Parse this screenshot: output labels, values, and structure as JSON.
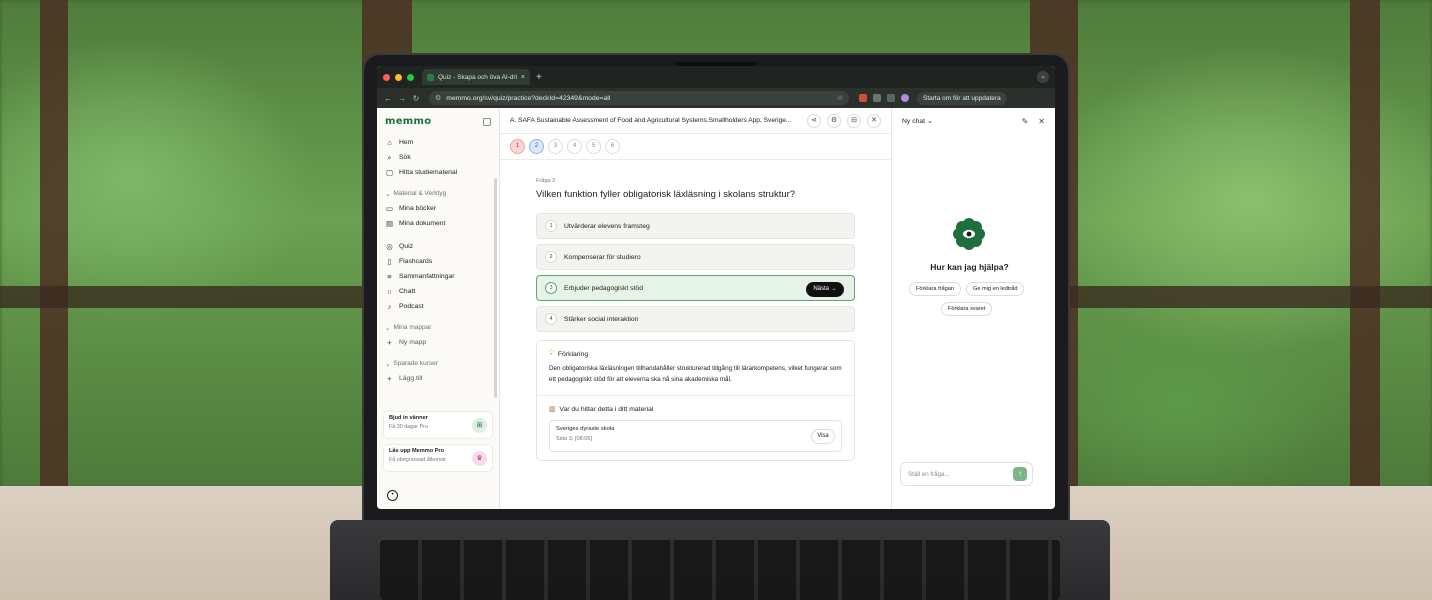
{
  "browser": {
    "tab_title": "Quiz - Skapa och öva AI-driv",
    "tab_close": "×",
    "new_tab": "+",
    "url": "memmo.org/sv/quiz/practice?deckId=42349&mode=all",
    "update_button": "Starta om för att uppdatera"
  },
  "sidebar": {
    "logo": "memmo",
    "items_top": [
      {
        "label": "Hem",
        "icon": "home-icon"
      },
      {
        "label": "Sök",
        "icon": "search-icon"
      },
      {
        "label": "Hitta studiematerial",
        "icon": "book-search-icon"
      }
    ],
    "section_material": "Material & Verktyg",
    "items_material": [
      {
        "label": "Mina böcker",
        "icon": "book-icon"
      },
      {
        "label": "Mina dokument",
        "icon": "document-icon"
      }
    ],
    "items_tools": [
      {
        "label": "Quiz",
        "icon": "quiz-icon"
      },
      {
        "label": "Flashcards",
        "icon": "flashcards-icon"
      },
      {
        "label": "Sammanfattningar",
        "icon": "summary-icon"
      },
      {
        "label": "Chatt",
        "icon": "chat-icon"
      },
      {
        "label": "Podcast",
        "icon": "podcast-icon"
      }
    ],
    "section_folders": "Mina mappar",
    "new_folder": "Ny mapp",
    "section_courses": "Sparade kurser",
    "add_course": "Lägg till",
    "promo_invite": {
      "title": "Bjud in vänner",
      "subtitle": "Få 30 dagar Pro"
    },
    "promo_pro": {
      "title": "Lås upp Memmo Pro",
      "subtitle": "Få obegränsad åtkomst"
    }
  },
  "quiz": {
    "title": "A. SAFA Sustainable Assessment of Food and Agricultural Systems.Smallholders App, Sverige...",
    "steps": [
      "1",
      "2",
      "3",
      "4",
      "5",
      "6"
    ],
    "question_number": "Fråga 2",
    "question": "Vilken funktion fyller obligatorisk läxläsning i skolans struktur?",
    "options": [
      {
        "n": "1",
        "text": "Utvärderar elevens framsteg"
      },
      {
        "n": "2",
        "text": "Kompenserar för studiero"
      },
      {
        "n": "3",
        "text": "Erbjuder pedagogiskt stöd"
      },
      {
        "n": "4",
        "text": "Stärker social interaktion"
      }
    ],
    "next_button": "Nästa →",
    "explanation_heading": "Förklaring",
    "explanation": "Den obligatoriska läxläsningen tillhandahåller strukturerad tillgång till lärarkompetens, vilket fungerar som ett pedagogiskt stöd för att eleverna ska nå sina akademiska mål.",
    "source_heading": "Var du hittar detta i ditt material",
    "source_title": "Sveriges dyraste skola",
    "source_location": "Sida 3, [08:05]",
    "view_button": "Visa"
  },
  "chat": {
    "title": "Ny chat",
    "help_heading": "Hur kan jag hjälpa?",
    "chips": [
      "Förklara frågan",
      "Ge mig en ledtråd",
      "Förklara svaret"
    ],
    "input_placeholder": "Ställ en fråga..."
  },
  "colors": {
    "brand": "#1f6e3f",
    "selected_border": "#5ea86e",
    "wrong": "#f9d6d3",
    "current": "#dbe9fb"
  }
}
